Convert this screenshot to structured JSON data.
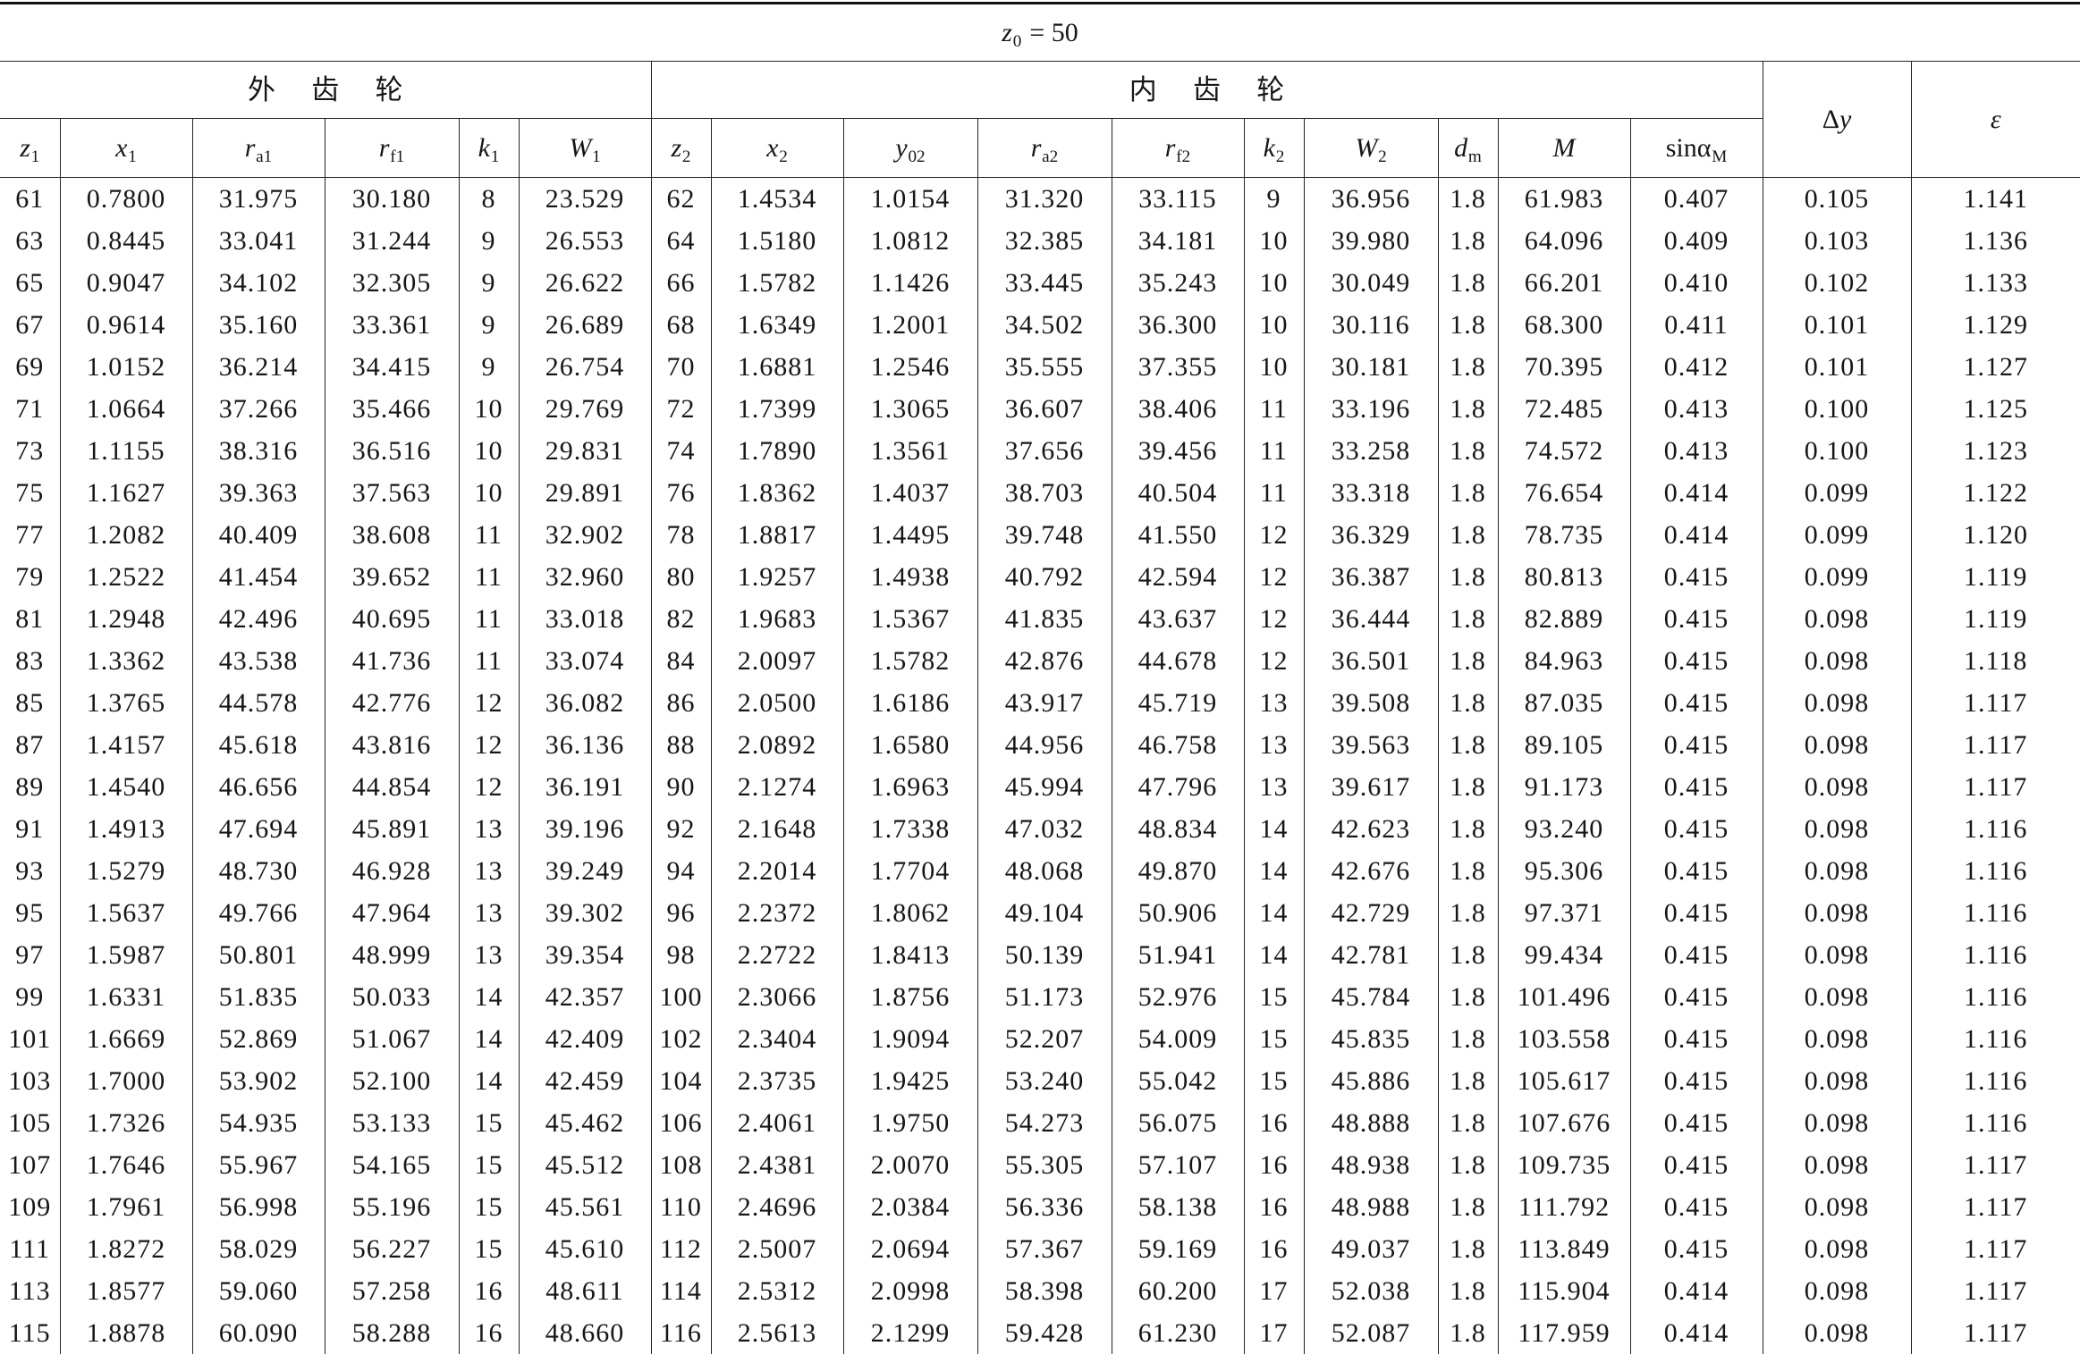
{
  "table": {
    "title": {
      "sym": "z",
      "sub": "0",
      "rest": "= 50"
    },
    "groups": {
      "outer": "外齿轮",
      "inner": "内齿轮"
    },
    "columns": [
      {
        "sym": "z",
        "sub": "1"
      },
      {
        "sym": "x",
        "sub": "1"
      },
      {
        "sym": "r",
        "sub": "a1"
      },
      {
        "sym": "r",
        "sub": "f1"
      },
      {
        "sym": "k",
        "sub": "1"
      },
      {
        "sym": "W",
        "sub": "1"
      },
      {
        "sym": "z",
        "sub": "2"
      },
      {
        "sym": "x",
        "sub": "2"
      },
      {
        "sym": "y",
        "sub": "02"
      },
      {
        "sym": "r",
        "sub": "a2"
      },
      {
        "sym": "r",
        "sub": "f2"
      },
      {
        "sym": "k",
        "sub": "2"
      },
      {
        "sym": "W",
        "sub": "2"
      },
      {
        "sym": "d",
        "sub": "m"
      },
      {
        "sym": "M"
      },
      {
        "pre": "sinα",
        "sub": "M"
      },
      {
        "pre": "Δ",
        "sym": "y"
      },
      {
        "sym": "ε"
      }
    ],
    "rows": [
      [
        "61",
        "0.7800",
        "31.975",
        "30.180",
        "8",
        "23.529",
        "62",
        "1.4534",
        "1.0154",
        "31.320",
        "33.115",
        "9",
        "36.956",
        "1.8",
        "61.983",
        "0.407",
        "0.105",
        "1.141"
      ],
      [
        "63",
        "0.8445",
        "33.041",
        "31.244",
        "9",
        "26.553",
        "64",
        "1.5180",
        "1.0812",
        "32.385",
        "34.181",
        "10",
        "39.980",
        "1.8",
        "64.096",
        "0.409",
        "0.103",
        "1.136"
      ],
      [
        "65",
        "0.9047",
        "34.102",
        "32.305",
        "9",
        "26.622",
        "66",
        "1.5782",
        "1.1426",
        "33.445",
        "35.243",
        "10",
        "30.049",
        "1.8",
        "66.201",
        "0.410",
        "0.102",
        "1.133"
      ],
      [
        "67",
        "0.9614",
        "35.160",
        "33.361",
        "9",
        "26.689",
        "68",
        "1.6349",
        "1.2001",
        "34.502",
        "36.300",
        "10",
        "30.116",
        "1.8",
        "68.300",
        "0.411",
        "0.101",
        "1.129"
      ],
      [
        "69",
        "1.0152",
        "36.214",
        "34.415",
        "9",
        "26.754",
        "70",
        "1.6881",
        "1.2546",
        "35.555",
        "37.355",
        "10",
        "30.181",
        "1.8",
        "70.395",
        "0.412",
        "0.101",
        "1.127"
      ],
      [
        "71",
        "1.0664",
        "37.266",
        "35.466",
        "10",
        "29.769",
        "72",
        "1.7399",
        "1.3065",
        "36.607",
        "38.406",
        "11",
        "33.196",
        "1.8",
        "72.485",
        "0.413",
        "0.100",
        "1.125"
      ],
      [
        "73",
        "1.1155",
        "38.316",
        "36.516",
        "10",
        "29.831",
        "74",
        "1.7890",
        "1.3561",
        "37.656",
        "39.456",
        "11",
        "33.258",
        "1.8",
        "74.572",
        "0.413",
        "0.100",
        "1.123"
      ],
      [
        "75",
        "1.1627",
        "39.363",
        "37.563",
        "10",
        "29.891",
        "76",
        "1.8362",
        "1.4037",
        "38.703",
        "40.504",
        "11",
        "33.318",
        "1.8",
        "76.654",
        "0.414",
        "0.099",
        "1.122"
      ],
      [
        "77",
        "1.2082",
        "40.409",
        "38.608",
        "11",
        "32.902",
        "78",
        "1.8817",
        "1.4495",
        "39.748",
        "41.550",
        "12",
        "36.329",
        "1.8",
        "78.735",
        "0.414",
        "0.099",
        "1.120"
      ],
      [
        "79",
        "1.2522",
        "41.454",
        "39.652",
        "11",
        "32.960",
        "80",
        "1.9257",
        "1.4938",
        "40.792",
        "42.594",
        "12",
        "36.387",
        "1.8",
        "80.813",
        "0.415",
        "0.099",
        "1.119"
      ],
      [
        "81",
        "1.2948",
        "42.496",
        "40.695",
        "11",
        "33.018",
        "82",
        "1.9683",
        "1.5367",
        "41.835",
        "43.637",
        "12",
        "36.444",
        "1.8",
        "82.889",
        "0.415",
        "0.098",
        "1.119"
      ],
      [
        "83",
        "1.3362",
        "43.538",
        "41.736",
        "11",
        "33.074",
        "84",
        "2.0097",
        "1.5782",
        "42.876",
        "44.678",
        "12",
        "36.501",
        "1.8",
        "84.963",
        "0.415",
        "0.098",
        "1.118"
      ],
      [
        "85",
        "1.3765",
        "44.578",
        "42.776",
        "12",
        "36.082",
        "86",
        "2.0500",
        "1.6186",
        "43.917",
        "45.719",
        "13",
        "39.508",
        "1.8",
        "87.035",
        "0.415",
        "0.098",
        "1.117"
      ],
      [
        "87",
        "1.4157",
        "45.618",
        "43.816",
        "12",
        "36.136",
        "88",
        "2.0892",
        "1.6580",
        "44.956",
        "46.758",
        "13",
        "39.563",
        "1.8",
        "89.105",
        "0.415",
        "0.098",
        "1.117"
      ],
      [
        "89",
        "1.4540",
        "46.656",
        "44.854",
        "12",
        "36.191",
        "90",
        "2.1274",
        "1.6963",
        "45.994",
        "47.796",
        "13",
        "39.617",
        "1.8",
        "91.173",
        "0.415",
        "0.098",
        "1.117"
      ],
      [
        "91",
        "1.4913",
        "47.694",
        "45.891",
        "13",
        "39.196",
        "92",
        "2.1648",
        "1.7338",
        "47.032",
        "48.834",
        "14",
        "42.623",
        "1.8",
        "93.240",
        "0.415",
        "0.098",
        "1.116"
      ],
      [
        "93",
        "1.5279",
        "48.730",
        "46.928",
        "13",
        "39.249",
        "94",
        "2.2014",
        "1.7704",
        "48.068",
        "49.870",
        "14",
        "42.676",
        "1.8",
        "95.306",
        "0.415",
        "0.098",
        "1.116"
      ],
      [
        "95",
        "1.5637",
        "49.766",
        "47.964",
        "13",
        "39.302",
        "96",
        "2.2372",
        "1.8062",
        "49.104",
        "50.906",
        "14",
        "42.729",
        "1.8",
        "97.371",
        "0.415",
        "0.098",
        "1.116"
      ],
      [
        "97",
        "1.5987",
        "50.801",
        "48.999",
        "13",
        "39.354",
        "98",
        "2.2722",
        "1.8413",
        "50.139",
        "51.941",
        "14",
        "42.781",
        "1.8",
        "99.434",
        "0.415",
        "0.098",
        "1.116"
      ],
      [
        "99",
        "1.6331",
        "51.835",
        "50.033",
        "14",
        "42.357",
        "100",
        "2.3066",
        "1.8756",
        "51.173",
        "52.976",
        "15",
        "45.784",
        "1.8",
        "101.496",
        "0.415",
        "0.098",
        "1.116"
      ],
      [
        "101",
        "1.6669",
        "52.869",
        "51.067",
        "14",
        "42.409",
        "102",
        "2.3404",
        "1.9094",
        "52.207",
        "54.009",
        "15",
        "45.835",
        "1.8",
        "103.558",
        "0.415",
        "0.098",
        "1.116"
      ],
      [
        "103",
        "1.7000",
        "53.902",
        "52.100",
        "14",
        "42.459",
        "104",
        "2.3735",
        "1.9425",
        "53.240",
        "55.042",
        "15",
        "45.886",
        "1.8",
        "105.617",
        "0.415",
        "0.098",
        "1.116"
      ],
      [
        "105",
        "1.7326",
        "54.935",
        "53.133",
        "15",
        "45.462",
        "106",
        "2.4061",
        "1.9750",
        "54.273",
        "56.075",
        "16",
        "48.888",
        "1.8",
        "107.676",
        "0.415",
        "0.098",
        "1.116"
      ],
      [
        "107",
        "1.7646",
        "55.967",
        "54.165",
        "15",
        "45.512",
        "108",
        "2.4381",
        "2.0070",
        "55.305",
        "57.107",
        "16",
        "48.938",
        "1.8",
        "109.735",
        "0.415",
        "0.098",
        "1.117"
      ],
      [
        "109",
        "1.7961",
        "56.998",
        "55.196",
        "15",
        "45.561",
        "110",
        "2.4696",
        "2.0384",
        "56.336",
        "58.138",
        "16",
        "48.988",
        "1.8",
        "111.792",
        "0.415",
        "0.098",
        "1.117"
      ],
      [
        "111",
        "1.8272",
        "58.029",
        "56.227",
        "15",
        "45.610",
        "112",
        "2.5007",
        "2.0694",
        "57.367",
        "59.169",
        "16",
        "49.037",
        "1.8",
        "113.849",
        "0.415",
        "0.098",
        "1.117"
      ],
      [
        "113",
        "1.8577",
        "59.060",
        "57.258",
        "16",
        "48.611",
        "114",
        "2.5312",
        "2.0998",
        "58.398",
        "60.200",
        "17",
        "52.038",
        "1.8",
        "115.904",
        "0.414",
        "0.098",
        "1.117"
      ],
      [
        "115",
        "1.8878",
        "60.090",
        "58.288",
        "16",
        "48.660",
        "116",
        "2.5613",
        "2.1299",
        "59.428",
        "61.230",
        "17",
        "52.087",
        "1.8",
        "117.959",
        "0.414",
        "0.098",
        "1.117"
      ]
    ]
  }
}
